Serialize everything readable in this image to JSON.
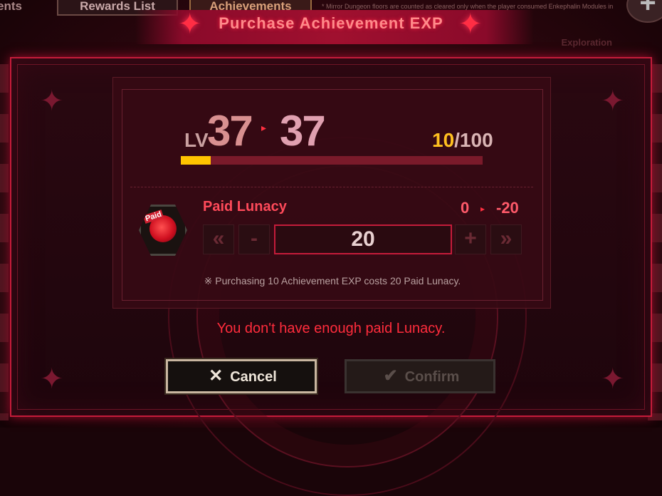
{
  "background": {
    "tabs": [
      "ents",
      "Rewards List",
      "Achievements List"
    ],
    "note": "* Mirror Dungeon floors are counted as cleared only when the player consumed Enkephalin Modules in the Reward Claim window.",
    "plus_label": "+",
    "exploration_label": "Exploration"
  },
  "dialog": {
    "title": "Purchase Achievement EXP",
    "level": {
      "label": "LV",
      "from": "37",
      "to": "37",
      "arrow": "▸",
      "exp_current": "10",
      "exp_max": "/100",
      "exp_fraction": 0.1
    },
    "item": {
      "name": "Paid Lunacy",
      "icon_badge": "Paid",
      "icon": "rose-icon",
      "cost_from": "0",
      "cost_to": "-20",
      "arrow": "▸"
    },
    "quantity": {
      "value": "20",
      "min_label": "«",
      "minus_label": "-",
      "plus_label": "+",
      "max_label": "»"
    },
    "footnote": "※ Purchasing 10 Achievement EXP costs 20 Paid Lunacy.",
    "error": "You don't have enough paid Lunacy.",
    "buttons": {
      "cancel": "Cancel",
      "cancel_icon": "✕",
      "confirm": "Confirm",
      "confirm_icon": "✔"
    }
  },
  "colors": {
    "accent_red": "#c41c3a",
    "exp_fill": "#ffc400",
    "error": "#ff2c3c"
  }
}
